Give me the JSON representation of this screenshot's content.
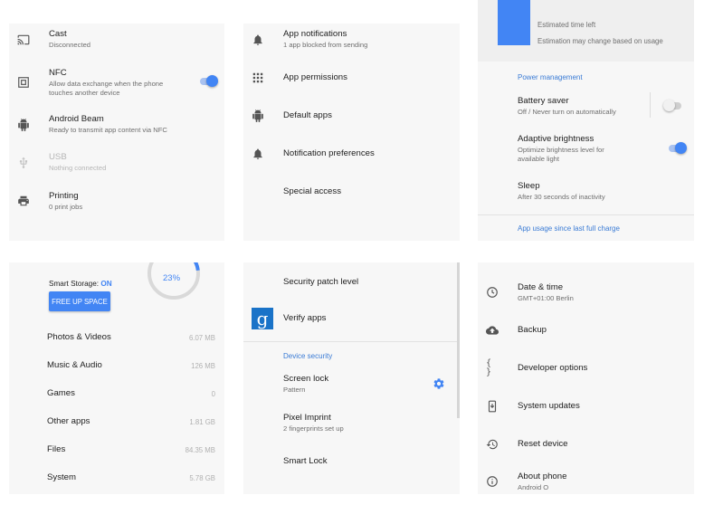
{
  "connected_devices": {
    "items": [
      {
        "title": "Cast",
        "subtitle": "Disconnected",
        "icon": "cast-icon"
      },
      {
        "title": "NFC",
        "subtitle_line1": "Allow data exchange when the phone",
        "subtitle_line2": "touches another device",
        "icon": "nfc-icon",
        "toggle": "on"
      },
      {
        "title": "Android Beam",
        "subtitle": "Ready to transmit app content via NFC",
        "icon": "android-icon"
      },
      {
        "title": "USB",
        "subtitle": "Nothing connected",
        "icon": "usb-icon",
        "disabled": true
      },
      {
        "title": "Printing",
        "subtitle": "0 print jobs",
        "icon": "print-icon"
      }
    ]
  },
  "apps": {
    "items": [
      {
        "title": "App notifications",
        "subtitle": "1 app blocked from sending",
        "icon": "bell-icon"
      },
      {
        "title": "App permissions",
        "icon": "grid-icon"
      },
      {
        "title": "Default apps",
        "icon": "android-icon"
      },
      {
        "title": "Notification preferences",
        "icon": "bell-icon"
      },
      {
        "title": "Special access"
      }
    ]
  },
  "battery": {
    "estimate_title": "Estimated time left",
    "estimate_note": "Estimation may change based on usage",
    "section_header": "Power management",
    "battery_saver": {
      "title": "Battery saver",
      "subtitle": "Off / Never turn on automatically",
      "toggle": "off"
    },
    "adaptive_brightness": {
      "title": "Adaptive brightness",
      "subtitle_line1": "Optimize brightness level for",
      "subtitle_line2": "available light",
      "toggle": "on"
    },
    "sleep": {
      "title": "Sleep",
      "subtitle": "After 30 seconds of inactivity"
    },
    "footer_link": "App usage since last full charge"
  },
  "storage": {
    "percent_label": "23%",
    "percent_used": 23,
    "smart_storage_prefix": "Smart Storage: ",
    "smart_storage_state": "ON",
    "free_up_button": "FREE UP SPACE",
    "items": [
      {
        "label": "Photos & Videos",
        "value": "6.07 MB"
      },
      {
        "label": "Music & Audio",
        "value": "126 MB"
      },
      {
        "label": "Games",
        "value": "0"
      },
      {
        "label": "Other apps",
        "value": "1.81 GB"
      },
      {
        "label": "Files",
        "value": "84.35 MB"
      },
      {
        "label": "System",
        "value": "5.78 GB"
      }
    ]
  },
  "security": {
    "patch_level": "Security patch level",
    "verify_apps": "Verify apps",
    "section_header": "Device security",
    "screen_lock": {
      "title": "Screen lock",
      "subtitle": "Pattern"
    },
    "pixel_imprint": {
      "title": "Pixel Imprint",
      "subtitle": "2 fingerprints set up"
    },
    "smart_lock": "Smart Lock"
  },
  "system": {
    "items": [
      {
        "title": "Date & time",
        "subtitle": "GMT+01:00 Berlin",
        "icon": "clock-icon"
      },
      {
        "title": "Backup",
        "icon": "cloud-upload-icon"
      },
      {
        "title": "Developer options",
        "icon": "braces-icon"
      },
      {
        "title": "System updates",
        "icon": "system-update-icon"
      },
      {
        "title": "Reset device",
        "icon": "restore-icon"
      },
      {
        "title": "About phone",
        "subtitle": "Android O",
        "icon": "info-icon"
      }
    ]
  },
  "colors": {
    "accent": "#4285f4",
    "link": "#3a7bd5",
    "panel_bg": "#f7f7f7"
  }
}
